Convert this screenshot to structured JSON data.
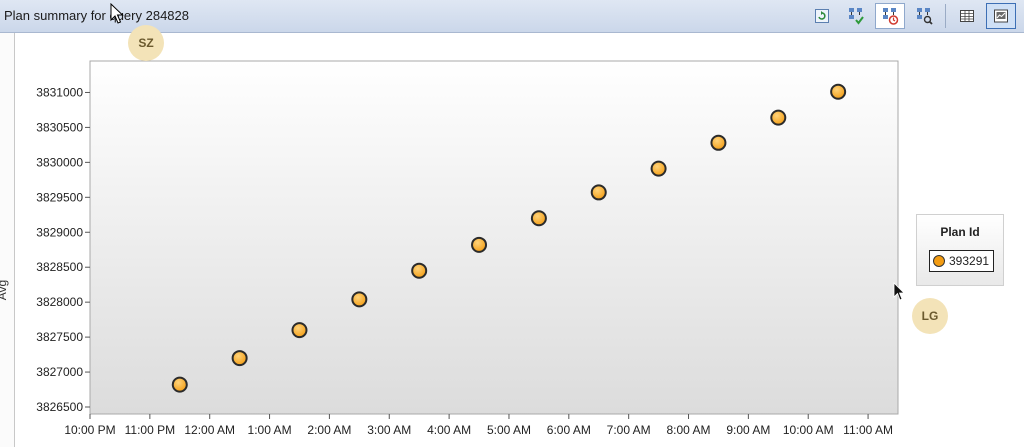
{
  "window": {
    "title": "Plan summary for query 284828"
  },
  "toolbar": {
    "buttons": [
      {
        "icon": "refresh-icon",
        "state": "normal"
      },
      {
        "icon": "force-plan-icon",
        "state": "normal"
      },
      {
        "icon": "compare-plans-icon",
        "state": "active"
      },
      {
        "icon": "unforce-plan-icon",
        "state": "normal"
      },
      {
        "icon": "grid-view-icon",
        "state": "normal"
      },
      {
        "icon": "chart-view-icon",
        "state": "pressed"
      }
    ]
  },
  "badges": {
    "top": "SZ",
    "right": "LG"
  },
  "legend": {
    "title": "Plan Id",
    "items": [
      {
        "label": "393291",
        "color": "#f39c12"
      }
    ]
  },
  "chart_data": {
    "type": "scatter",
    "ylabel": "Avg",
    "xlabel": "",
    "y_ticks": [
      3826500,
      3827000,
      3827500,
      3828000,
      3828500,
      3829000,
      3829500,
      3830000,
      3830500,
      3831000
    ],
    "y_tick_labels": [
      "3826500",
      "3827000",
      "3827500",
      "3828000",
      "3828500",
      "3829000",
      "3829500",
      "3830000",
      "3830500",
      "3831000"
    ],
    "ylim": [
      3826400,
      3831450
    ],
    "x_tick_labels": [
      "10:00 PM",
      "11:00 PM",
      "12:00 AM",
      "1:00 AM",
      "2:00 AM",
      "3:00 AM",
      "4:00 AM",
      "5:00 AM",
      "6:00 AM",
      "7:00 AM",
      "8:00 AM",
      "9:00 AM",
      "10:00 AM",
      "11:00 AM"
    ],
    "xlim": [
      "10:00 PM",
      "11:30 AM"
    ],
    "grid": false,
    "legend_position": "right",
    "series": [
      {
        "name": "393291",
        "color": "#f39c12",
        "points": [
          {
            "x": "11:30 PM",
            "y": 3826820
          },
          {
            "x": "12:30 AM",
            "y": 3827200
          },
          {
            "x": "1:30 AM",
            "y": 3827600
          },
          {
            "x": "2:30 AM",
            "y": 3828040
          },
          {
            "x": "3:30 AM",
            "y": 3828450
          },
          {
            "x": "4:30 AM",
            "y": 3828820
          },
          {
            "x": "5:30 AM",
            "y": 3829200
          },
          {
            "x": "6:30 AM",
            "y": 3829570
          },
          {
            "x": "7:30 AM",
            "y": 3829910
          },
          {
            "x": "8:30 AM",
            "y": 3830280
          },
          {
            "x": "9:30 AM",
            "y": 3830640
          },
          {
            "x": "10:30 AM",
            "y": 3831010
          }
        ]
      }
    ]
  }
}
